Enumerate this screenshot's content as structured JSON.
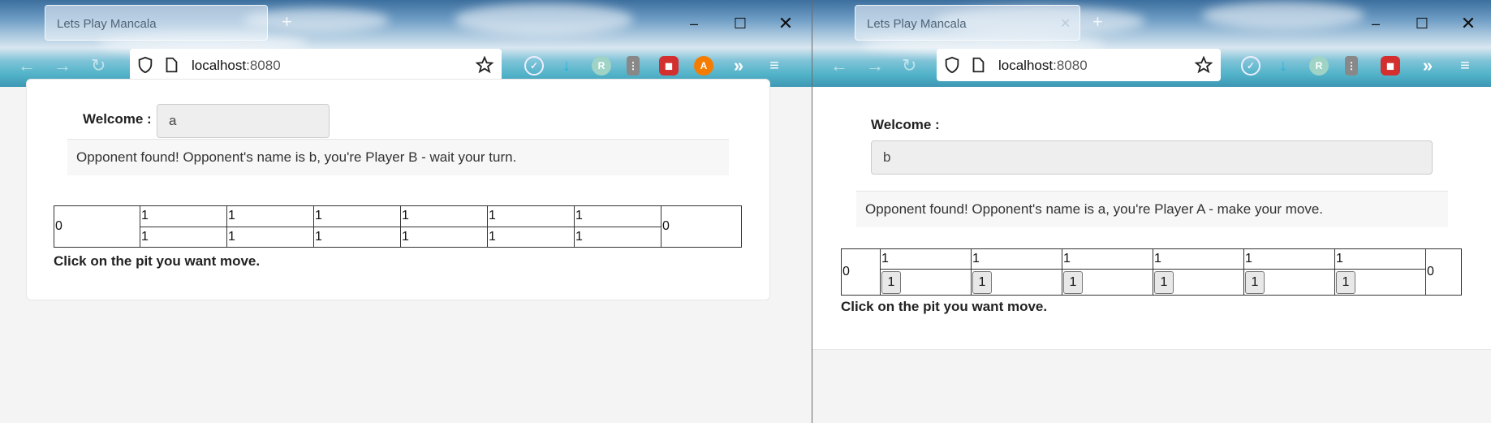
{
  "left_window": {
    "tab_title": "Lets Play Mancala",
    "url_host": "localhost",
    "url_port": ":8080",
    "welcome_label": "Welcome :",
    "name_value": "a",
    "message": "Opponent found! Opponent's name is b, you're Player B - wait your turn.",
    "board": {
      "left_store": "0",
      "right_store": "0",
      "top_pits": [
        "1",
        "1",
        "1",
        "1",
        "1",
        "1"
      ],
      "bottom_pits": [
        "1",
        "1",
        "1",
        "1",
        "1",
        "1"
      ]
    },
    "hint": "Click on the pit you want move."
  },
  "right_window": {
    "tab_title": "Lets Play Mancala",
    "url_host": "localhost",
    "url_port": ":8080",
    "welcome_label": "Welcome :",
    "name_value": "b",
    "message": "Opponent found! Opponent's name is a, you're Player A - make your move.",
    "board": {
      "left_store": "0",
      "right_store": "0",
      "top_pits": [
        "1",
        "1",
        "1",
        "1",
        "1",
        "1"
      ],
      "bottom_pits": [
        "1",
        "1",
        "1",
        "1",
        "1",
        "1"
      ]
    },
    "hint": "Click on the pit you want move."
  },
  "colors": {
    "adblock_red": "#d32f2f",
    "avast_orange": "#f57c00",
    "pocket_teal": "#4fc3d0",
    "download_blue": "#2bb0e0"
  }
}
